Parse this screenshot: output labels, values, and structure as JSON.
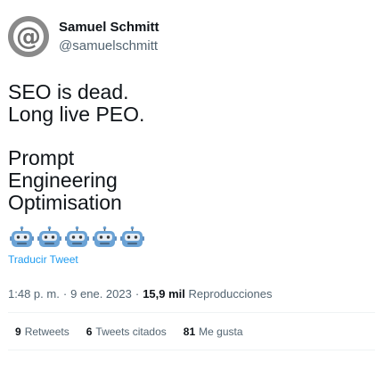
{
  "author": {
    "display_name": "Samuel Schmitt",
    "handle": "@samuelschmitt",
    "avatar_icon": "at-sign-icon",
    "avatar_glyph": "@"
  },
  "tweet": {
    "lines": [
      "SEO is dead.",
      "Long live PEO.",
      "",
      "Prompt",
      "Engineering",
      "Optimisation"
    ],
    "emoji_count": 5,
    "emoji_name": "robot-face-emoji"
  },
  "translate_label": "Traducir Tweet",
  "meta": {
    "time": "1:48 p. m.",
    "separator": "·",
    "date": "9 ene. 2023",
    "views_count": "15,9 mil",
    "views_label": "Reproducciones"
  },
  "stats": [
    {
      "count": "9",
      "label": "Retweets"
    },
    {
      "count": "6",
      "label": "Tweets citados"
    },
    {
      "count": "81",
      "label": "Me gusta"
    }
  ],
  "colors": {
    "text_primary": "#0f1419",
    "text_secondary": "#536471",
    "link": "#1d9bf0",
    "divider": "#eff3f4",
    "emoji_blue": "#6ba3d6"
  }
}
